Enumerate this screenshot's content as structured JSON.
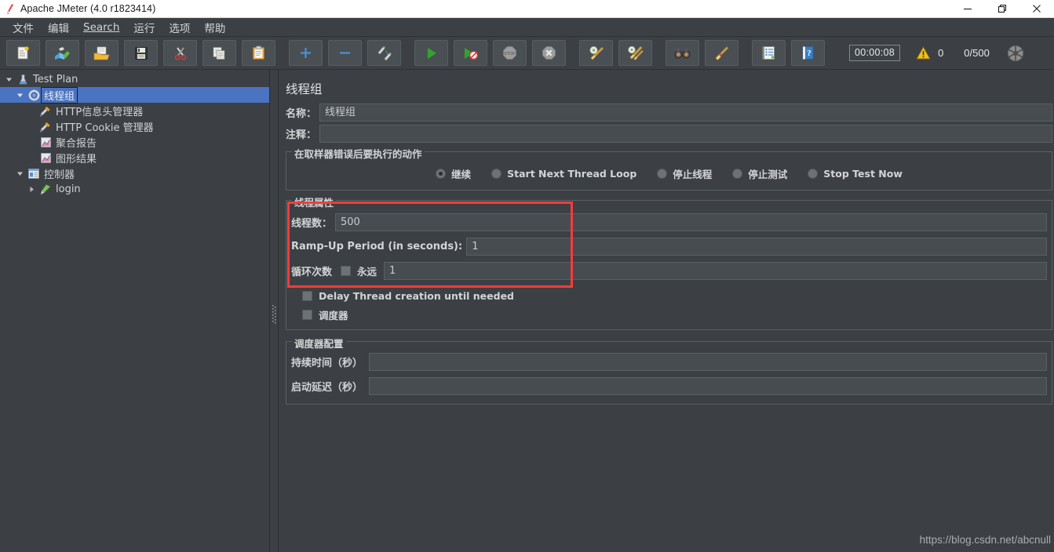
{
  "window": {
    "title": "Apache JMeter (4.0 r1823414)",
    "app_icon": "jmeter-feather-icon",
    "controls": {
      "minimize": "–",
      "restore": "❐",
      "close": "✕"
    }
  },
  "menubar": {
    "items": [
      {
        "label": "文件",
        "underlined": false
      },
      {
        "label": "编辑",
        "underlined": false
      },
      {
        "label": "Search",
        "underlined": true
      },
      {
        "label": "运行",
        "underlined": false
      },
      {
        "label": "选项",
        "underlined": false
      },
      {
        "label": "帮助",
        "underlined": false
      }
    ]
  },
  "toolbar": {
    "buttons": [
      {
        "name": "new-test-plan-button",
        "icon": "new-document-icon"
      },
      {
        "name": "templates-button",
        "icon": "templates-icon"
      },
      {
        "name": "open-button",
        "icon": "open-folder-icon"
      },
      {
        "name": "save-button",
        "icon": "floppy-save-icon"
      },
      {
        "name": "cut-button",
        "icon": "scissors-icon"
      },
      {
        "name": "copy-button",
        "icon": "copy-pages-icon"
      },
      {
        "name": "paste-button",
        "icon": "clipboard-paste-icon"
      },
      {
        "name": "expand-all-button",
        "icon": "plus-icon"
      },
      {
        "name": "collapse-all-button",
        "icon": "minus-icon"
      },
      {
        "name": "toggle-button",
        "icon": "toggle-pencils-icon"
      },
      {
        "name": "start-button",
        "icon": "play-green-icon"
      },
      {
        "name": "start-no-pauses-button",
        "icon": "play-no-timers-icon"
      },
      {
        "name": "stop-button",
        "icon": "stop-sign-icon"
      },
      {
        "name": "shutdown-button",
        "icon": "shutdown-x-icon"
      },
      {
        "name": "clear-button",
        "icon": "gear-broom-icon"
      },
      {
        "name": "clear-all-button",
        "icon": "gear-brooms-icon"
      },
      {
        "name": "search-button",
        "icon": "binoculars-icon"
      },
      {
        "name": "reset-search-button",
        "icon": "broom-icon"
      },
      {
        "name": "function-helper-button",
        "icon": "notebook-list-icon"
      },
      {
        "name": "help-button",
        "icon": "help-book-icon"
      }
    ],
    "elapsed_time": "00:00:08",
    "warning_count": "0",
    "thread_count": "0/500",
    "connection_icon": "connections-indicator-icon"
  },
  "tree": {
    "nodes": [
      {
        "label": "Test Plan",
        "icon": "test-plan-icon",
        "indent": 0,
        "twisty": "down",
        "selected": false
      },
      {
        "label": "线程组",
        "icon": "thread-group-icon",
        "indent": 1,
        "twisty": "down",
        "selected": true
      },
      {
        "label": "HTTP信息头管理器",
        "icon": "header-manager-icon",
        "indent": 2,
        "twisty": "none",
        "selected": false
      },
      {
        "label": "HTTP Cookie 管理器",
        "icon": "cookie-manager-icon",
        "indent": 2,
        "twisty": "none",
        "selected": false
      },
      {
        "label": "聚合报告",
        "icon": "aggregate-report-icon",
        "indent": 2,
        "twisty": "none",
        "selected": false
      },
      {
        "label": "图形结果",
        "icon": "graph-results-icon",
        "indent": 2,
        "twisty": "none",
        "selected": false
      },
      {
        "label": "控制器",
        "icon": "logic-controller-icon",
        "indent": 2,
        "twisty": "down",
        "selected": false
      },
      {
        "label": "login",
        "icon": "http-sampler-icon",
        "indent": 3,
        "twisty": "right",
        "selected": false
      }
    ]
  },
  "panel": {
    "title": "线程组",
    "name_label": "名称：",
    "name_value": "线程组",
    "comment_label": "注释：",
    "comment_value": "",
    "error_action": {
      "legend": "在取样器错误后要执行的动作",
      "options": [
        {
          "label": "继续",
          "checked": true
        },
        {
          "label": "Start Next Thread Loop",
          "checked": false
        },
        {
          "label": "停止线程",
          "checked": false
        },
        {
          "label": "停止测试",
          "checked": false
        },
        {
          "label": "Stop Test Now",
          "checked": false
        }
      ]
    },
    "thread_properties": {
      "legend": "线程属性",
      "threads_label": "线程数：",
      "threads_value": "500",
      "rampup_label": "Ramp-Up Period (in seconds):",
      "rampup_value": "1",
      "loop_label": "循环次数",
      "forever_label": "永远",
      "forever_checked": false,
      "loop_value": "1",
      "delay_creation_label": "Delay Thread creation until needed",
      "delay_creation_checked": false,
      "scheduler_label": "调度器",
      "scheduler_checked": false
    },
    "scheduler_config": {
      "legend": "调度器配置",
      "duration_label": "持续时间（秒）",
      "duration_value": "",
      "startup_delay_label": "启动延迟（秒）",
      "startup_delay_value": ""
    },
    "annotation": {
      "name": "red-highlight-box",
      "color": "#f93b3b"
    }
  },
  "watermark": "https://blog.csdn.net/abcnull",
  "colors": {
    "background": "#3c4044",
    "field_bg": "#474c50",
    "selection_blue": "#4a74c2",
    "text": "#d2d4d6",
    "accent_red": "#f93b3b"
  }
}
